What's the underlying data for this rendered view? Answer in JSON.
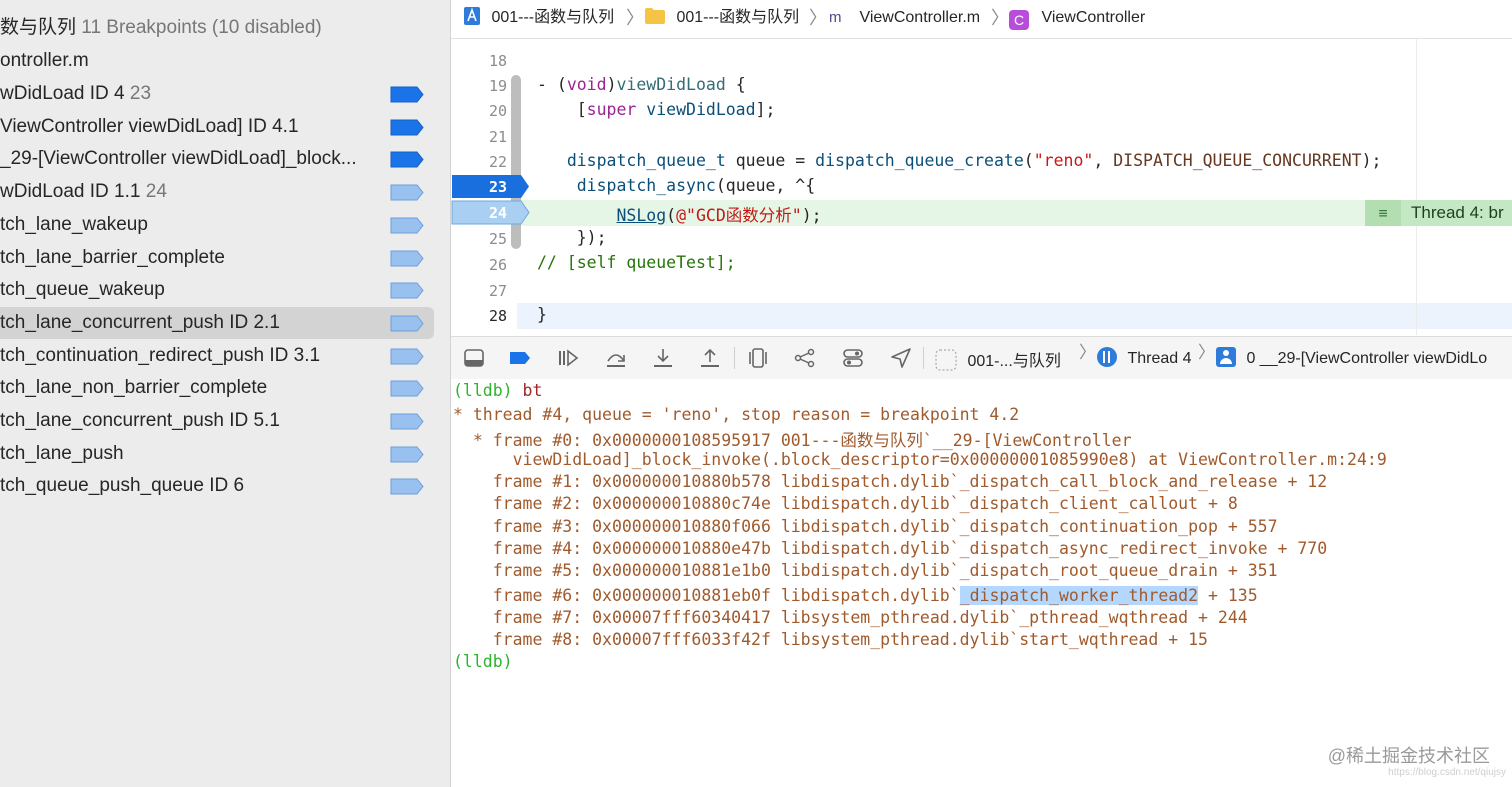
{
  "navigator": {
    "header_name": "数与队列",
    "header_count": "11 Breakpoints (10 disabled)",
    "file": "ontroller.m",
    "items": [
      {
        "label": "wDidLoad ID 4",
        "num": " 23",
        "state": "enabled"
      },
      {
        "label": "ViewController viewDidLoad]  ID 4.1",
        "num": "",
        "state": "enabled"
      },
      {
        "label": "_29-[ViewController viewDidLoad]_block...",
        "num": "",
        "state": "enabled"
      },
      {
        "label": "wDidLoad  ID 1.1",
        "num": " 24",
        "state": "disabled"
      },
      {
        "label": "tch_lane_wakeup",
        "num": "",
        "state": "disabled"
      },
      {
        "label": "tch_lane_barrier_complete",
        "num": "",
        "state": "disabled"
      },
      {
        "label": "tch_queue_wakeup",
        "num": "",
        "state": "disabled"
      },
      {
        "label": "tch_lane_concurrent_push  ID 2.1",
        "num": "",
        "state": "disabled",
        "selected": true
      },
      {
        "label": "tch_continuation_redirect_push  ID 3.1",
        "num": "",
        "state": "disabled"
      },
      {
        "label": "tch_lane_non_barrier_complete",
        "num": "",
        "state": "disabled"
      },
      {
        "label": "tch_lane_concurrent_push  ID 5.1",
        "num": "",
        "state": "disabled"
      },
      {
        "label": "tch_lane_push",
        "num": "",
        "state": "disabled"
      },
      {
        "label": "tch_queue_push_queue ID 6",
        "num": "",
        "state": "disabled"
      }
    ]
  },
  "breadcrumb": {
    "project": "001---函数与队列",
    "folder": "001---函数与队列",
    "file_badge": "m",
    "file": "ViewController.m",
    "class_badge": "C",
    "class": "ViewController"
  },
  "editor": {
    "lines": [
      {
        "n": "18"
      },
      {
        "n": "19"
      },
      {
        "n": "20"
      },
      {
        "n": "21"
      },
      {
        "n": "22"
      },
      {
        "n": "23"
      },
      {
        "n": "24"
      },
      {
        "n": "25"
      },
      {
        "n": "26"
      },
      {
        "n": "27"
      },
      {
        "n": "28"
      }
    ],
    "code": {
      "l19a": "- (",
      "l19b": "void",
      "l19c": ")",
      "l19d": "viewDidLoad",
      "l19e": " {",
      "l20a": "    [",
      "l20b": "super",
      "l20c": " ",
      "l20d": "viewDidLoad",
      "l20e": "];",
      "l22a": "   ",
      "l22b": "dispatch_queue_t",
      "l22c": " queue = ",
      "l22d": "dispatch_queue_create",
      "l22e": "(",
      "l22f": "\"reno\"",
      "l22g": ", ",
      "l22h": "DISPATCH_QUEUE_CONCURRENT",
      "l22i": ");",
      "l23a": "    ",
      "l23b": "dispatch_async",
      "l23c": "(queue, ^{",
      "l24a": "        ",
      "l24b": "NSLog",
      "l24c": "(",
      "l24d": "@\"GCD函数分析\"",
      "l24e": ");",
      "l25": "    });",
      "l26": "// [self queueTest];",
      "l28": "}"
    },
    "thread_badge": "Thread 4: br"
  },
  "debug_bar": {
    "target": "001-...与队列",
    "thread": "Thread 4",
    "frame": "0 __29-[ViewController viewDidLo"
  },
  "console": {
    "prompt": "(lldb)",
    "command": " bt",
    "lines": [
      "* thread #4, queue = 'reno', stop reason = breakpoint 4.2",
      "  * frame #0: 0x0000000108595917 001---函数与队列`__29-[ViewController",
      "      viewDidLoad]_block_invoke(.block_descriptor=0x00000001085990e8) at ViewController.m:24:9",
      "    frame #1: 0x000000010880b578 libdispatch.dylib`_dispatch_call_block_and_release + 12",
      "    frame #2: 0x000000010880c74e libdispatch.dylib`_dispatch_client_callout + 8",
      "    frame #3: 0x000000010880f066 libdispatch.dylib`_dispatch_continuation_pop + 557",
      "    frame #4: 0x000000010880e47b libdispatch.dylib`_dispatch_async_redirect_invoke + 770",
      "    frame #5: 0x000000010881e1b0 libdispatch.dylib`_dispatch_root_queue_drain + 351"
    ],
    "line6_pre": "    frame #6: 0x000000010881eb0f libdispatch.dylib`",
    "line6_hl": "_dispatch_worker_thread2",
    "line6_post": " + 135",
    "lines_after": [
      "    frame #7: 0x00007fff60340417 libsystem_pthread.dylib`_pthread_wqthread + 244",
      "    frame #8: 0x00007fff6033f42f libsystem_pthread.dylib`start_wqthread + 15"
    ],
    "end_prompt": "(lldb)"
  },
  "watermark": "@稀土掘金技术社区",
  "watermark_small": "https://blog.csdn.net/qiujsy",
  "colors": {
    "breakpoint_enabled": "#1a73e8",
    "breakpoint_disabled": "#98c1ef",
    "current_line": "#e6f6e6",
    "lldb_prompt": "#2fb42f"
  }
}
